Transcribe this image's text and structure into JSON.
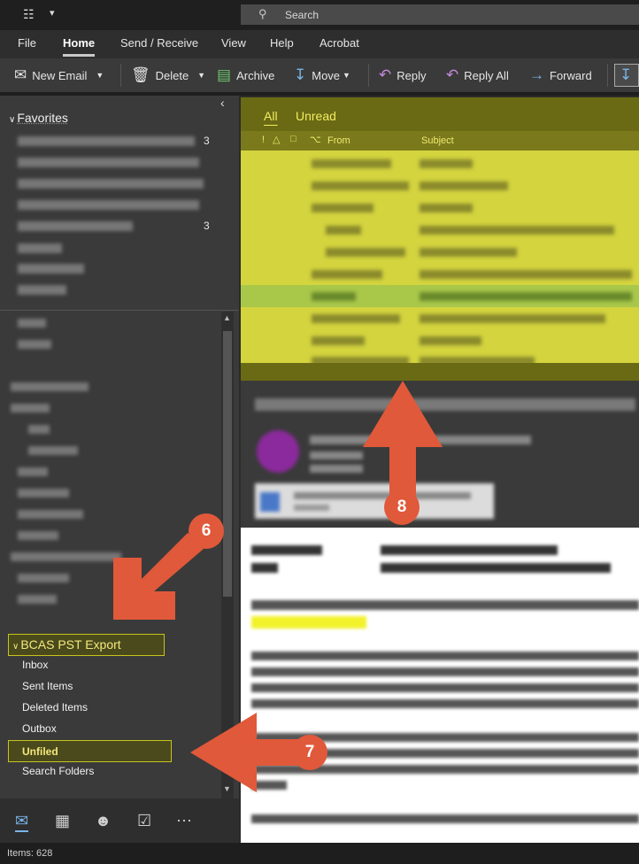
{
  "search": {
    "placeholder": "Search"
  },
  "ribbon_tabs": [
    "File",
    "Home",
    "Send / Receive",
    "View",
    "Help",
    "Acrobat"
  ],
  "ribbon": {
    "new_email": "New Email",
    "delete": "Delete",
    "archive": "Archive",
    "move": "Move",
    "reply": "Reply",
    "reply_all": "Reply All",
    "forward": "Forward"
  },
  "nav": {
    "favorites": "Favorites",
    "favorites_counts": [
      "3",
      "3"
    ],
    "account_name": "BCAS PST Export",
    "folders": [
      "Inbox",
      "Sent Items",
      "Deleted Items",
      "Outbox",
      "Unfiled",
      "Search Folders"
    ]
  },
  "list": {
    "tabs": [
      "All",
      "Unread"
    ],
    "columns": {
      "from": "From",
      "subject": "Subject"
    }
  },
  "status": {
    "items": "Items: 628"
  },
  "callouts": [
    "6",
    "7",
    "8"
  ],
  "colors": {
    "highlight_fill": "#4a4a1c",
    "highlight_border": "#c7c41f",
    "arrow": "#e0593a",
    "list_yellow": "#d4d43f"
  }
}
